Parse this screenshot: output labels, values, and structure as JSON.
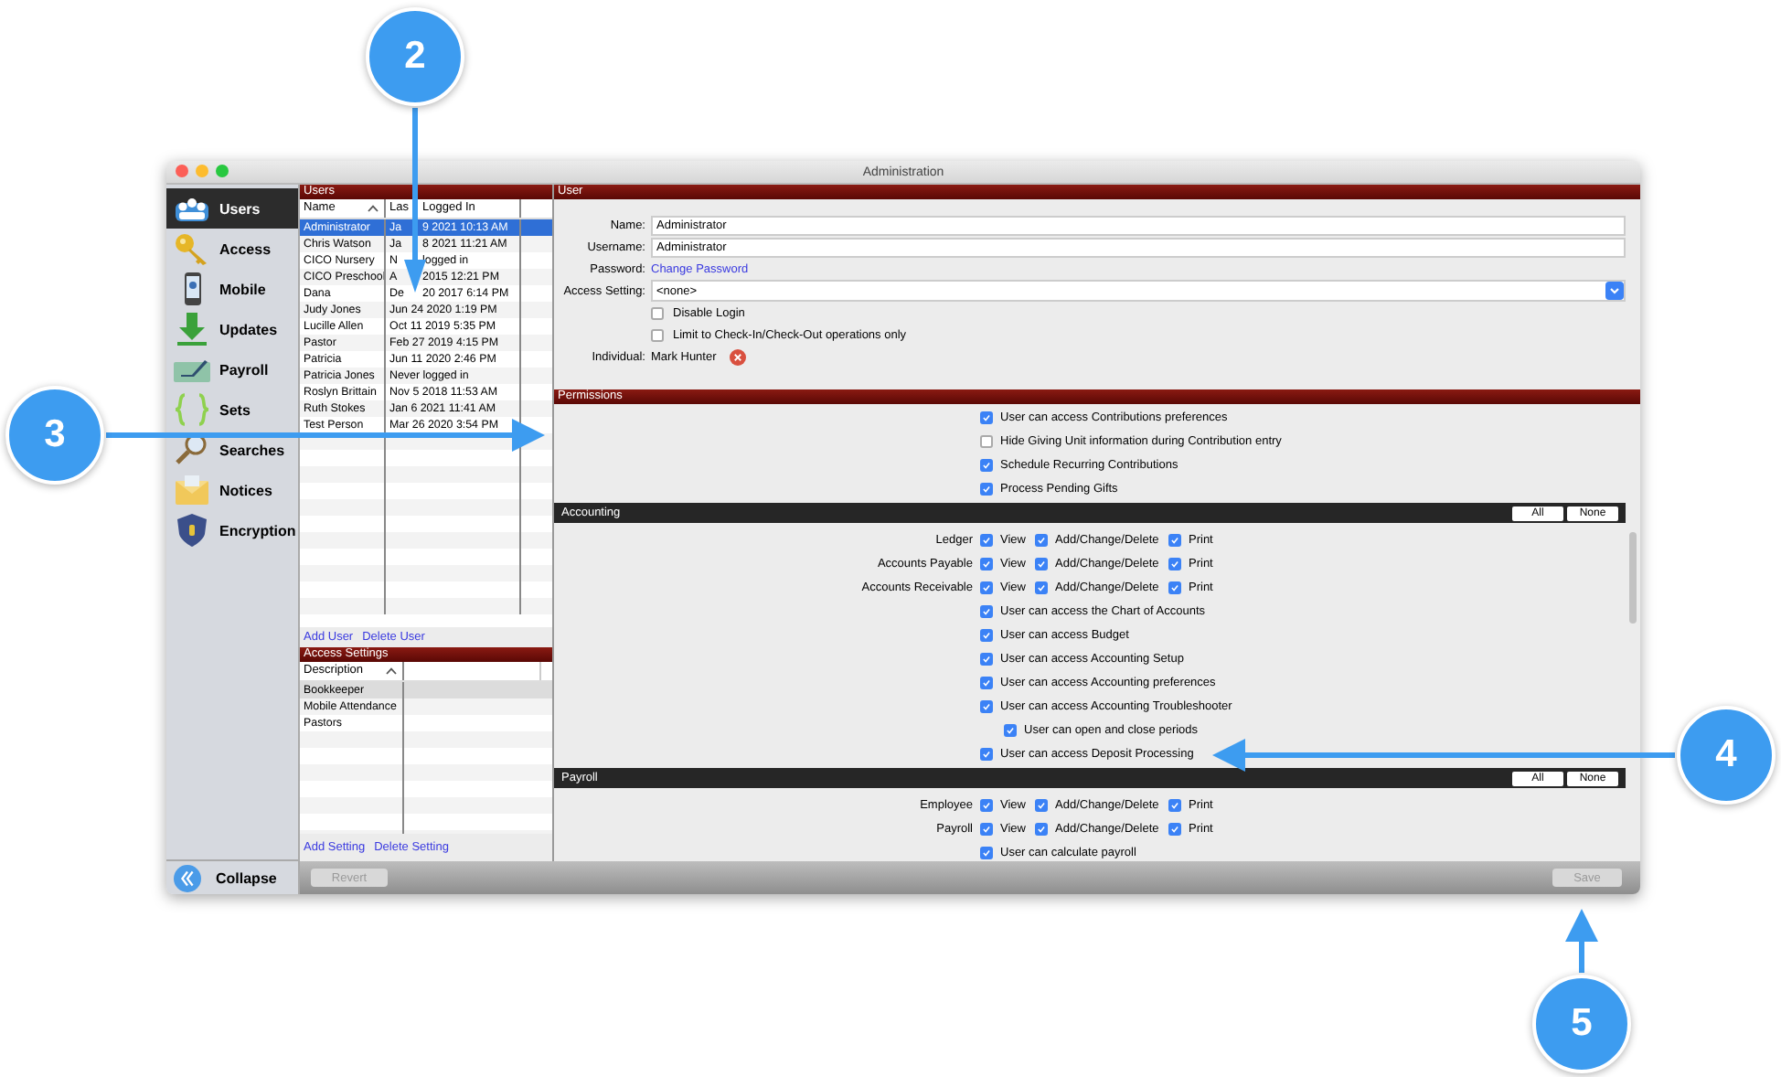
{
  "window": {
    "title": "Administration"
  },
  "sidebar": {
    "items": [
      {
        "label": "Users",
        "selected": true
      },
      {
        "label": "Access",
        "selected": false
      },
      {
        "label": "Mobile",
        "selected": false
      },
      {
        "label": "Updates",
        "selected": false
      },
      {
        "label": "Payroll",
        "selected": false
      },
      {
        "label": "Sets",
        "selected": false
      },
      {
        "label": "Searches",
        "selected": false
      },
      {
        "label": "Notices",
        "selected": false
      },
      {
        "label": "Encryption",
        "selected": false
      }
    ],
    "collapse": "Collapse"
  },
  "users": {
    "title": "Users",
    "columns": [
      [
        "Name"
      ],
      [
        "Las",
        "Logged In"
      ]
    ],
    "rows": [
      {
        "name": "Administrator",
        "last_login": [
          "Ja",
          "9 2021 10:13 AM"
        ],
        "selected": true
      },
      {
        "name": "Chris Watson",
        "last_login": [
          "Ja",
          "8 2021 11:21 AM"
        ],
        "selected": false
      },
      {
        "name": "CICO Nursery",
        "last_login": [
          "N",
          "logged in"
        ],
        "selected": false
      },
      {
        "name": "CICO Preschool",
        "last_login": [
          "A",
          "2015 12:21 PM"
        ],
        "selected": false
      },
      {
        "name": "Dana",
        "last_login": [
          "De",
          "20 2017 6:14 PM"
        ],
        "selected": false
      },
      {
        "name": "Judy Jones",
        "last_login": [
          "Jun 24 2020 1:19 PM"
        ],
        "selected": false
      },
      {
        "name": "Lucille Allen",
        "last_login": [
          "Oct 11 2019 5:35 PM"
        ],
        "selected": false
      },
      {
        "name": "Pastor",
        "last_login": [
          "Feb 27 2019 4:15 PM"
        ],
        "selected": false
      },
      {
        "name": "Patricia",
        "last_login": [
          "Jun 11 2020 2:46 PM"
        ],
        "selected": false
      },
      {
        "name": "Patricia Jones",
        "last_login": [
          "Never logged in"
        ],
        "selected": false
      },
      {
        "name": "Roslyn Brittain",
        "last_login": [
          "Nov 5 2018 11:53 AM"
        ],
        "selected": false
      },
      {
        "name": "Ruth Stokes",
        "last_login": [
          "Jan 6 2021 11:41 AM"
        ],
        "selected": false
      },
      {
        "name": "Test Person",
        "last_login": [
          "Mar 26 2020 3:54 PM"
        ],
        "selected": false
      }
    ],
    "links": [
      "Add User",
      "Delete User"
    ]
  },
  "access_settings": {
    "title": "Access Settings",
    "columns": [
      "Description"
    ],
    "rows": [
      {
        "description": "Bookkeeper",
        "selected": true
      },
      {
        "description": "Mobile Attendance",
        "selected": false
      },
      {
        "description": "Pastors",
        "selected": false
      }
    ],
    "links": [
      "Add Setting",
      "Delete Setting"
    ]
  },
  "user": {
    "title": "User",
    "name": {
      "label": "Name:",
      "value": "Administrator"
    },
    "username": {
      "label": "Username:",
      "value": "Administrator"
    },
    "password": {
      "label": "Password:",
      "link": "Change Password"
    },
    "access_setting": {
      "label": "Access Setting:",
      "value": "<none>"
    },
    "options": [
      {
        "label": "Disable Login",
        "checked": false
      },
      {
        "label": "Limit to Check-In/Check-Out operations only",
        "checked": false
      }
    ],
    "individual": {
      "label": "Individual:",
      "value": "Mark Hunter"
    }
  },
  "permissions": {
    "title": "Permissions",
    "items": [
      {
        "kind": "check",
        "label": "User can access Contributions preferences",
        "checked": true
      },
      {
        "kind": "check",
        "label": "Hide Giving Unit information during Contribution entry",
        "checked": false
      },
      {
        "kind": "check",
        "label": "Schedule Recurring Contributions",
        "checked": true
      },
      {
        "kind": "check",
        "label": "Process Pending Gifts",
        "checked": true
      },
      {
        "kind": "section",
        "title": "Accounting",
        "buttons": [
          "All",
          "None"
        ]
      },
      {
        "kind": "grid",
        "label": "Ledger",
        "options": [
          {
            "label": "View",
            "checked": true
          },
          {
            "label": "Add/Change/Delete",
            "checked": true
          },
          {
            "label": "Print",
            "checked": true
          }
        ]
      },
      {
        "kind": "grid",
        "label": "Accounts Payable",
        "options": [
          {
            "label": "View",
            "checked": true
          },
          {
            "label": "Add/Change/Delete",
            "checked": true
          },
          {
            "label": "Print",
            "checked": true
          }
        ]
      },
      {
        "kind": "grid",
        "label": "Accounts Receivable",
        "options": [
          {
            "label": "View",
            "checked": true
          },
          {
            "label": "Add/Change/Delete",
            "checked": true
          },
          {
            "label": "Print",
            "checked": true
          }
        ]
      },
      {
        "kind": "check",
        "label": "User can access the Chart of Accounts",
        "checked": true
      },
      {
        "kind": "check",
        "label": "User can access Budget",
        "checked": true
      },
      {
        "kind": "check",
        "label": "User can access Accounting Setup",
        "checked": true
      },
      {
        "kind": "check",
        "label": "User can access Accounting preferences",
        "checked": true
      },
      {
        "kind": "check",
        "label": "User can access Accounting Troubleshooter",
        "checked": true,
        "children": [
          {
            "label": "User can open and close periods",
            "checked": true
          }
        ]
      },
      {
        "kind": "check",
        "label": "User can access Deposit Processing",
        "checked": true
      },
      {
        "kind": "section",
        "title": "Payroll",
        "buttons": [
          "All",
          "None"
        ]
      },
      {
        "kind": "grid",
        "label": "Employee",
        "options": [
          {
            "label": "View",
            "checked": true
          },
          {
            "label": "Add/Change/Delete",
            "checked": true
          },
          {
            "label": "Print",
            "checked": true
          }
        ]
      },
      {
        "kind": "grid",
        "label": "Payroll",
        "options": [
          {
            "label": "View",
            "checked": true
          },
          {
            "label": "Add/Change/Delete",
            "checked": true
          },
          {
            "label": "Print",
            "checked": true
          }
        ]
      },
      {
        "kind": "check",
        "label": "User can calculate payroll",
        "checked": true
      }
    ]
  },
  "bottom_bar": {
    "buttons": [
      {
        "label": "Revert",
        "disabled": true
      },
      {
        "label": "Save",
        "disabled": true
      }
    ]
  },
  "callouts": [
    {
      "number": "2"
    },
    {
      "number": "3"
    },
    {
      "number": "4"
    },
    {
      "number": "5"
    }
  ]
}
